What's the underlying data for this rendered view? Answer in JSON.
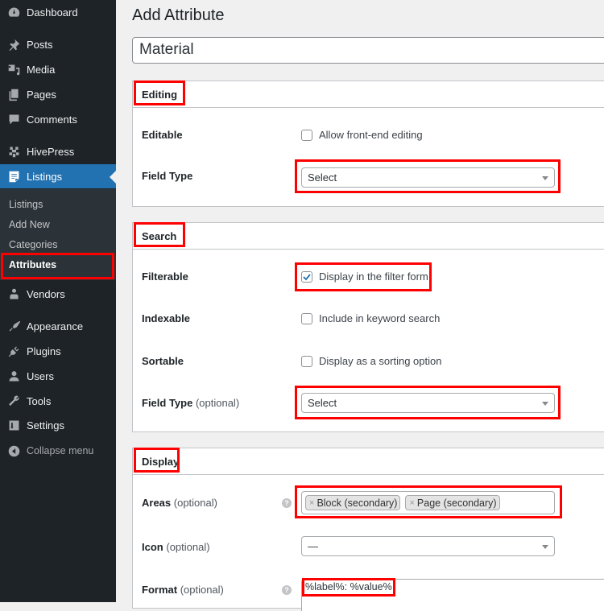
{
  "sidebar": {
    "items": [
      {
        "label": "Dashboard",
        "icon": "dashboard-icon"
      },
      {
        "label": "Posts",
        "icon": "pin-icon"
      },
      {
        "label": "Media",
        "icon": "media-icon"
      },
      {
        "label": "Pages",
        "icon": "pages-icon"
      },
      {
        "label": "Comments",
        "icon": "comment-icon"
      },
      {
        "label": "HivePress",
        "icon": "hivepress-icon"
      },
      {
        "label": "Listings",
        "icon": "listings-icon",
        "active": true
      },
      {
        "label": "Vendors",
        "icon": "vendor-icon"
      },
      {
        "label": "Appearance",
        "icon": "brush-icon"
      },
      {
        "label": "Plugins",
        "icon": "plugin-icon"
      },
      {
        "label": "Users",
        "icon": "user-icon"
      },
      {
        "label": "Tools",
        "icon": "wrench-icon"
      },
      {
        "label": "Settings",
        "icon": "settings-icon"
      }
    ],
    "submenu": [
      "Listings",
      "Add New",
      "Categories",
      "Attributes"
    ],
    "current_submenu": "Attributes",
    "collapse_label": "Collapse menu"
  },
  "page": {
    "title": "Add Attribute",
    "attribute_name": "Material"
  },
  "editing": {
    "heading": "Editing",
    "editable_label": "Editable",
    "editable_option": "Allow front-end editing",
    "editable_checked": false,
    "field_type_label": "Field Type",
    "field_type_value": "Select"
  },
  "search": {
    "heading": "Search",
    "filterable_label": "Filterable",
    "filterable_option": "Display in the filter form",
    "filterable_checked": true,
    "indexable_label": "Indexable",
    "indexable_option": "Include in keyword search",
    "sortable_label": "Sortable",
    "sortable_option": "Display as a sorting option",
    "field_type_label": "Field Type",
    "optional": "(optional)",
    "field_type_value": "Select"
  },
  "display": {
    "heading": "Display",
    "areas_label": "Areas",
    "areas_tags": [
      "Block (secondary)",
      "Page (secondary)"
    ],
    "icon_label": "Icon",
    "icon_value": "—",
    "format_label": "Format",
    "format_value": "%label%: %value%",
    "optional": "(optional)",
    "help_glyph": "?",
    "remove_glyph": "×"
  },
  "colors": {
    "sidebar_bg": "#1d2327",
    "active_bg": "#2271b1",
    "highlight": "#ff0000",
    "check": "#2271b1"
  }
}
